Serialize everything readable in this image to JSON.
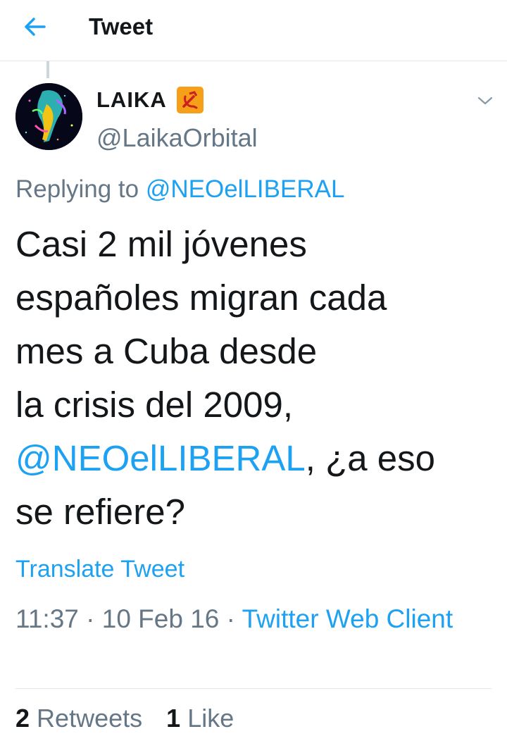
{
  "header": {
    "title": "Tweet",
    "back_icon": "arrow-left-icon",
    "accent_color": "#1da1f2"
  },
  "tweet": {
    "author": {
      "display_name": "LAIKA",
      "name_emoji": "hammer-and-sickle-emoji",
      "handle": "@LaikaOrbital"
    },
    "more_icon": "chevron-down-icon",
    "replying_to_label": "Replying to",
    "replying_to_handle": "@NEOelLIBERAL",
    "text_lines": [
      "Casi 2 mil jóvenes",
      "españoles migran cada",
      "mes a Cuba desde",
      "la crisis del 2009,"
    ],
    "mention": "@NEOelLIBERAL",
    "text_after_mention": ", ¿a eso",
    "text_last_line": "se refiere?",
    "translate_label": "Translate Tweet",
    "time": "11:37",
    "date": "10 Feb 16",
    "separator": "·",
    "source": "Twitter Web Client",
    "retweets_count": "2",
    "retweets_label": "Retweets",
    "likes_count": "1",
    "likes_label": "Like"
  }
}
